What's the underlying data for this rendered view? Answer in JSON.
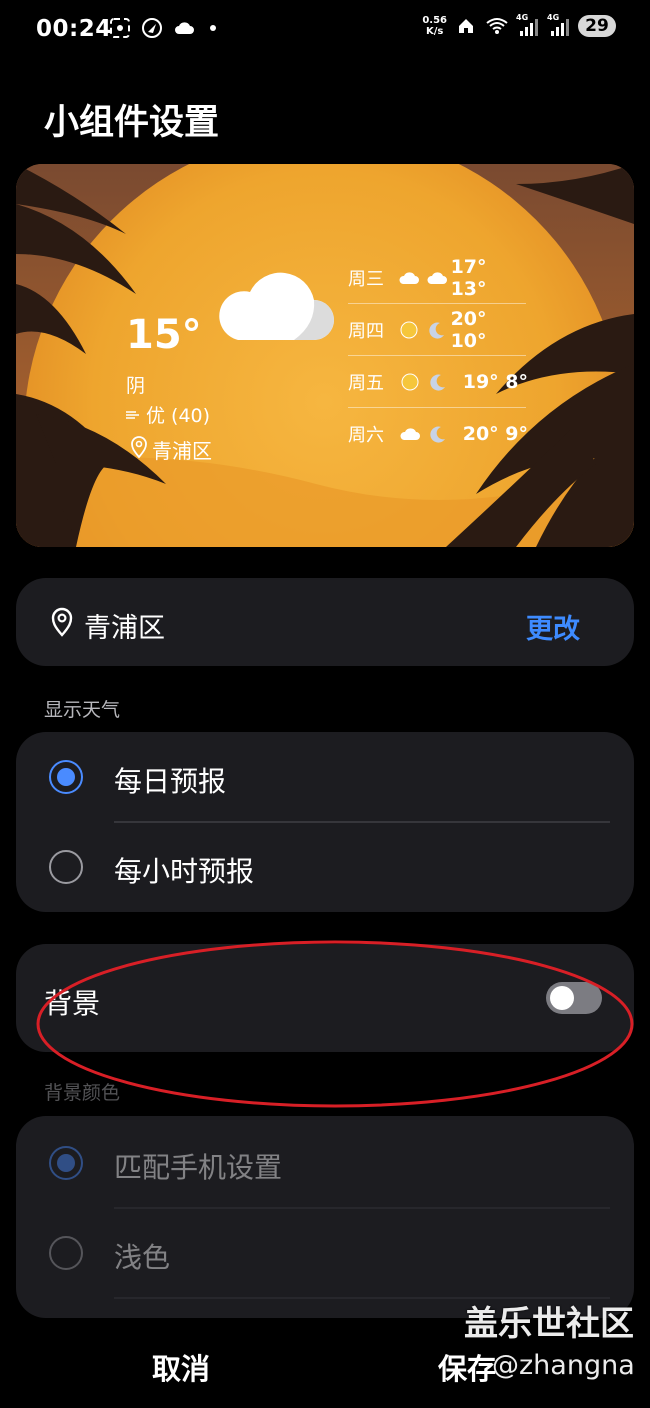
{
  "status_bar": {
    "time": "00:24",
    "net_speed_value": "0.56",
    "net_speed_unit": "K/s",
    "signal1_label": "4G",
    "signal2_label": "4G",
    "wifi_label": "6",
    "battery": "29"
  },
  "page_title": "小组件设置",
  "widget": {
    "temperature": "15°",
    "condition": "阴",
    "air_quality": "优 (40)",
    "location": "青浦区",
    "forecast": [
      {
        "day": "周三",
        "icon1": "cloud-icon",
        "icon2": "cloud-icon",
        "temps": "17° 13°"
      },
      {
        "day": "周四",
        "icon1": "sun-icon",
        "icon2": "moon-icon",
        "temps": "20° 10°"
      },
      {
        "day": "周五",
        "icon1": "sun-icon",
        "icon2": "moon-icon",
        "temps": "19° 8°"
      },
      {
        "day": "周六",
        "icon1": "cloud-icon",
        "icon2": "moon-icon",
        "temps": "20° 9°"
      }
    ]
  },
  "location_card": {
    "label": "青浦区",
    "change_button": "更改"
  },
  "display_weather": {
    "section_title": "显示天气",
    "options": [
      {
        "label": "每日预报",
        "selected": true
      },
      {
        "label": "每小时预报",
        "selected": false
      }
    ]
  },
  "background": {
    "label": "背景",
    "enabled": false
  },
  "background_color": {
    "section_title": "背景颜色",
    "options": [
      {
        "label": "匹配手机设置",
        "selected": true
      },
      {
        "label": "浅色",
        "selected": false
      }
    ]
  },
  "footer": {
    "cancel": "取消",
    "save": "保存"
  },
  "watermark": {
    "line1": "盖乐世社区",
    "line2": "@zhangna"
  },
  "colors": {
    "accent": "#3e8bff",
    "annotation": "#d81f26",
    "card": "#1c1c20"
  }
}
